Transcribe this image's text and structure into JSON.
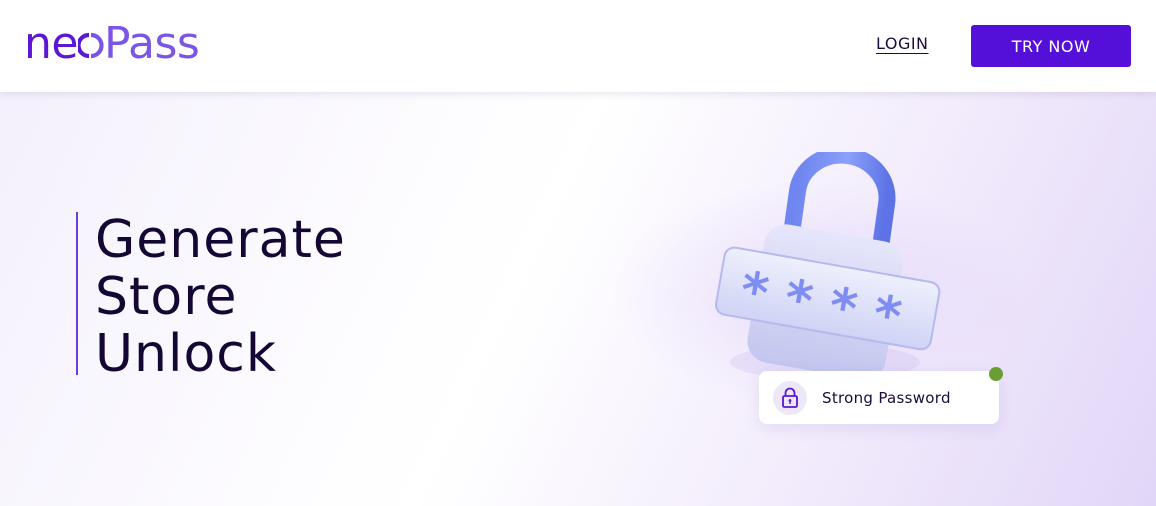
{
  "brand": {
    "logo_part_1": "ne",
    "logo_part_2": "Pass",
    "primary_color": "#5410d9",
    "secondary_color": "#7a55e6"
  },
  "nav": {
    "login_label": "LOGIN",
    "try_now_label": "TRY NOW"
  },
  "hero": {
    "tagline": [
      "Generate",
      "Store",
      "Unlock"
    ],
    "illustration": "padlock-password-icon",
    "strength_card": {
      "label": "Strong Password",
      "icon": "lock-icon",
      "status_color": "#6a9e35"
    }
  }
}
